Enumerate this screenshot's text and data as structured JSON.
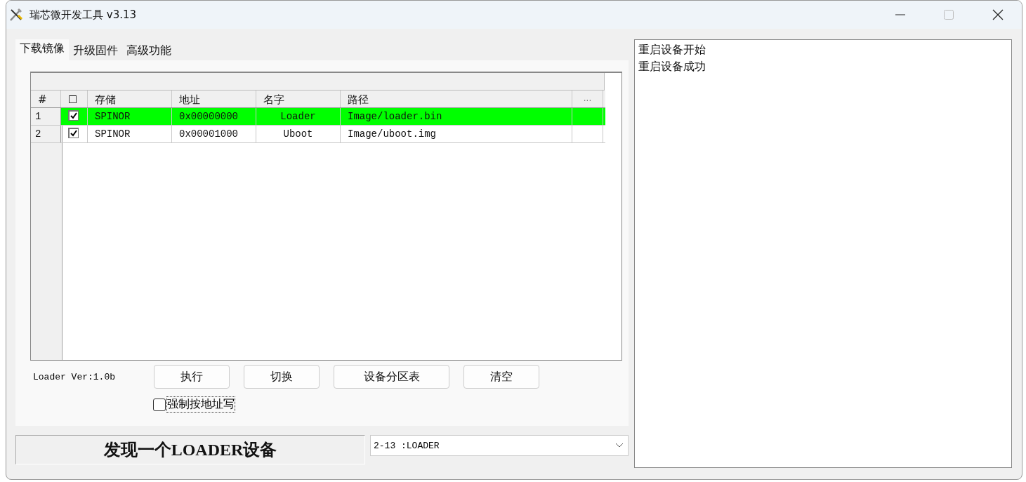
{
  "window": {
    "title": "瑞芯微开发工具 v3.13"
  },
  "tabs": [
    {
      "label": "下载镜像",
      "selected": true
    },
    {
      "label": "升级固件",
      "selected": false
    },
    {
      "label": "高级功能",
      "selected": false
    }
  ],
  "table": {
    "columns": [
      "#",
      "☐",
      "存储",
      "地址",
      "名字",
      "路径",
      "..."
    ],
    "rows": [
      {
        "index": "1",
        "checked": true,
        "selected": true,
        "storage": "SPINOR",
        "address": "0x00000000",
        "name": "Loader",
        "path": "Image/loader.bin"
      },
      {
        "index": "2",
        "checked": true,
        "selected": false,
        "storage": "SPINOR",
        "address": "0x00001000",
        "name": "Uboot",
        "path": "Image/uboot.img"
      }
    ]
  },
  "loader_version": "Loader Ver:1.0b",
  "buttons": [
    "执行",
    "切换",
    "设备分区表",
    "清空"
  ],
  "force_address_write": {
    "label": "强制按地址写",
    "checked": false
  },
  "status_message": "发现一个LOADER设备",
  "device_select": {
    "value": "2-13 :LOADER"
  },
  "log": [
    "重启设备开始",
    "重启设备成功"
  ]
}
